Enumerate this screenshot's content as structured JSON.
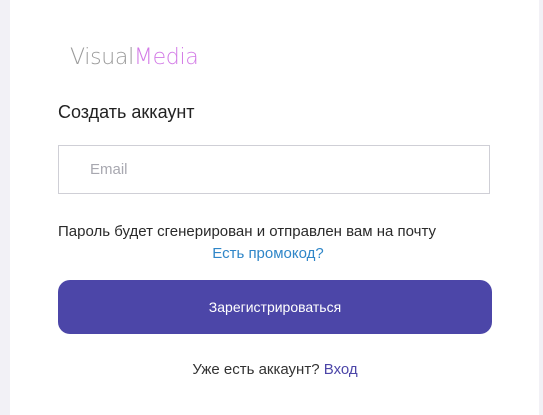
{
  "brand": {
    "logo_part1": "Visual",
    "logo_part2": "Media"
  },
  "form": {
    "heading": "Создать аккаунт",
    "email_placeholder": "Email",
    "email_value": "",
    "password_note": "Пароль будет сгенерирован и отправлен вам на почту",
    "promo_link": "Есть промокод?",
    "register_label": "Зарегистрироваться"
  },
  "footer": {
    "have_account": "Уже есть аккаунт?",
    "login_link": "Вход"
  },
  "colors": {
    "accent": "#4c46a8",
    "logo_pink": "#d27ae6",
    "link_blue": "#2f86c8"
  }
}
